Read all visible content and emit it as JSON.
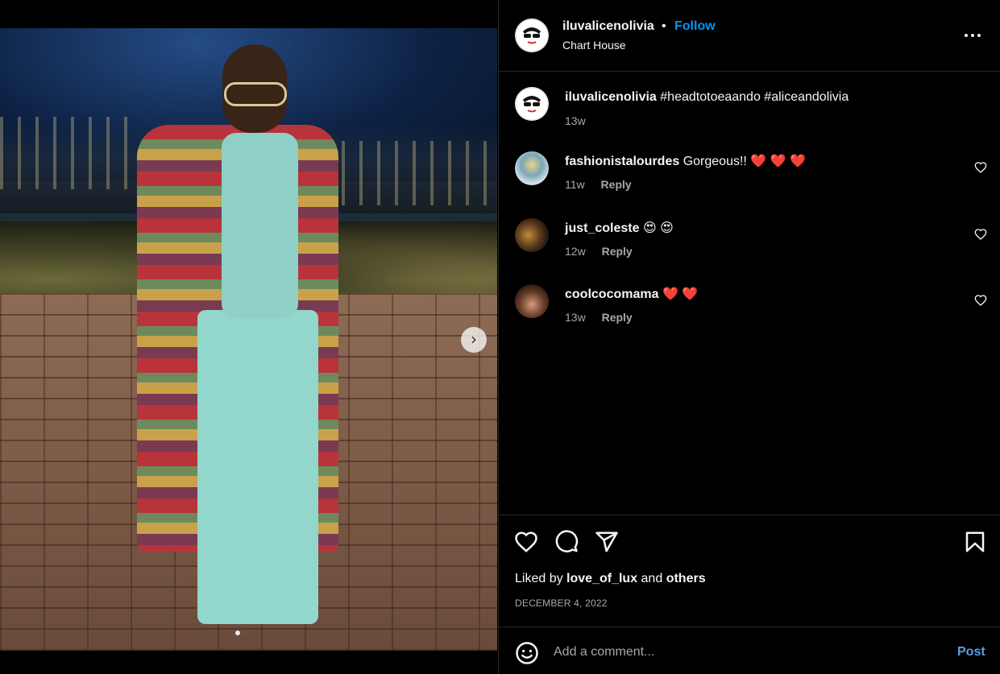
{
  "colors": {
    "background": "#000000",
    "text": "#f5f5f5",
    "secondary_text": "#a8a8a8",
    "follow_blue": "#0095f6",
    "divider": "#262626"
  },
  "media": {
    "next_icon": "chevron-right-icon",
    "image_alt": "Woman in a patterned long coat and mint-green knit outfit standing on a brick plaza at night"
  },
  "header": {
    "username": "iluvalicenolivia",
    "separator": "•",
    "follow_label": "Follow",
    "location": "Chart House",
    "more_icon": "more-options-icon"
  },
  "caption": {
    "username": "iluvalicenolivia",
    "text": "#headtotoeaando #aliceandolivia",
    "time": "13w"
  },
  "comments": [
    {
      "username": "fashionistalourdes",
      "text": "Gorgeous!! ❤️ ❤️ ❤️",
      "time": "11w",
      "reply_label": "Reply"
    },
    {
      "username": "just_coleste",
      "text": "😍 😍",
      "time": "12w",
      "reply_label": "Reply"
    },
    {
      "username": "coolcocomama",
      "text": "❤️ ❤️",
      "time": "13w",
      "reply_label": "Reply"
    }
  ],
  "actions": {
    "liked_prefix": "Liked by",
    "liked_user": "love_of_lux",
    "liked_and": "and",
    "liked_others": "others",
    "date": "DECEMBER 4, 2022"
  },
  "composer": {
    "placeholder": "Add a comment...",
    "post_label": "Post"
  }
}
